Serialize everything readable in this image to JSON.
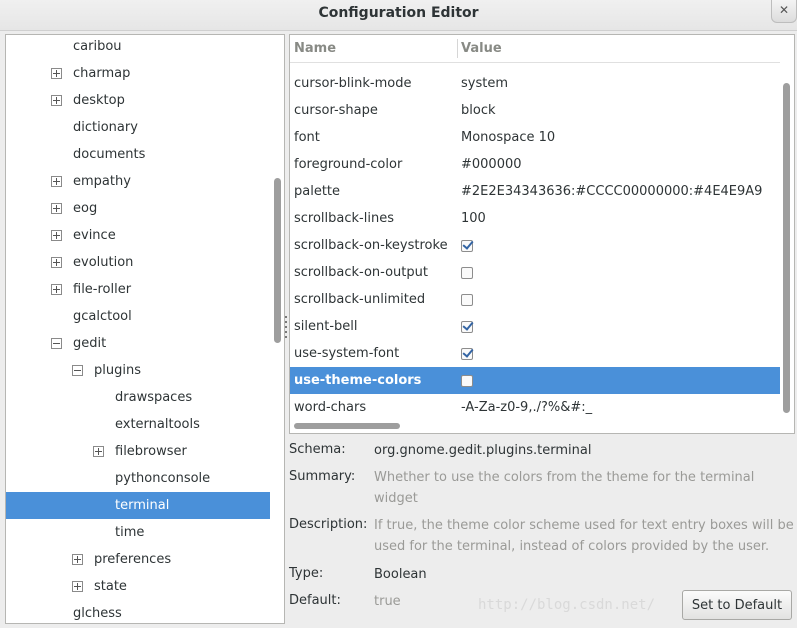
{
  "window": {
    "title": "Configuration Editor",
    "close_icon": "close-icon"
  },
  "tree": {
    "items": [
      {
        "label": "caribou",
        "expander": "none",
        "indent": 0,
        "selected": false
      },
      {
        "label": "charmap",
        "expander": "plus",
        "indent": 0,
        "selected": false
      },
      {
        "label": "desktop",
        "expander": "plus",
        "indent": 0,
        "selected": false
      },
      {
        "label": "dictionary",
        "expander": "none",
        "indent": 0,
        "selected": false
      },
      {
        "label": "documents",
        "expander": "none",
        "indent": 0,
        "selected": false
      },
      {
        "label": "empathy",
        "expander": "plus",
        "indent": 0,
        "selected": false
      },
      {
        "label": "eog",
        "expander": "plus",
        "indent": 0,
        "selected": false
      },
      {
        "label": "evince",
        "expander": "plus",
        "indent": 0,
        "selected": false
      },
      {
        "label": "evolution",
        "expander": "plus",
        "indent": 0,
        "selected": false
      },
      {
        "label": "file-roller",
        "expander": "plus",
        "indent": 0,
        "selected": false
      },
      {
        "label": "gcalctool",
        "expander": "none",
        "indent": 0,
        "selected": false
      },
      {
        "label": "gedit",
        "expander": "minus",
        "indent": 0,
        "selected": false
      },
      {
        "label": "plugins",
        "expander": "minus",
        "indent": 1,
        "selected": false
      },
      {
        "label": "drawspaces",
        "expander": "none",
        "indent": 2,
        "selected": false
      },
      {
        "label": "externaltools",
        "expander": "none",
        "indent": 2,
        "selected": false
      },
      {
        "label": "filebrowser",
        "expander": "plus",
        "indent": 2,
        "selected": false
      },
      {
        "label": "pythonconsole",
        "expander": "none",
        "indent": 2,
        "selected": false
      },
      {
        "label": "terminal",
        "expander": "none",
        "indent": 2,
        "selected": true
      },
      {
        "label": "time",
        "expander": "none",
        "indent": 2,
        "selected": false
      },
      {
        "label": "preferences",
        "expander": "plus",
        "indent": 1,
        "selected": false
      },
      {
        "label": "state",
        "expander": "plus",
        "indent": 1,
        "selected": false
      },
      {
        "label": "glchess",
        "expander": "none",
        "indent": 0,
        "selected": false
      }
    ]
  },
  "list": {
    "header": {
      "name": "Name",
      "value": "Value"
    },
    "rows": [
      {
        "name": "cursor-blink-mode",
        "type": "text",
        "value": "system",
        "selected": false
      },
      {
        "name": "cursor-shape",
        "type": "text",
        "value": "block",
        "selected": false
      },
      {
        "name": "font",
        "type": "text",
        "value": "Monospace 10",
        "selected": false
      },
      {
        "name": "foreground-color",
        "type": "text",
        "value": "#000000",
        "selected": false
      },
      {
        "name": "palette",
        "type": "text",
        "value": "#2E2E34343636:#CCCC00000000:#4E4E9A9",
        "selected": false
      },
      {
        "name": "scrollback-lines",
        "type": "text",
        "value": "100",
        "selected": false
      },
      {
        "name": "scrollback-on-keystroke",
        "type": "bool",
        "checked": true,
        "selected": false
      },
      {
        "name": "scrollback-on-output",
        "type": "bool",
        "checked": false,
        "selected": false
      },
      {
        "name": "scrollback-unlimited",
        "type": "bool",
        "checked": false,
        "selected": false
      },
      {
        "name": "silent-bell",
        "type": "bool",
        "checked": true,
        "selected": false
      },
      {
        "name": "use-system-font",
        "type": "bool",
        "checked": true,
        "selected": false
      },
      {
        "name": "use-theme-colors",
        "type": "bool",
        "checked": false,
        "selected": true
      },
      {
        "name": "word-chars",
        "type": "text",
        "value": "-A-Za-z0-9,./?%&#:_",
        "selected": false
      }
    ]
  },
  "details": {
    "schema_label": "Schema:",
    "schema_value": "org.gnome.gedit.plugins.terminal",
    "summary_label": "Summary:",
    "summary_value": "Whether to use the colors from the theme for the terminal widget",
    "description_label": "Description:",
    "description_value": "If true, the theme color scheme used for text entry boxes will be used for the terminal, instead of colors provided by the user.",
    "type_label": "Type:",
    "type_value": "Boolean",
    "default_label": "Default:",
    "default_value": "true"
  },
  "buttons": {
    "set_default": "Set to Default"
  },
  "watermark": "http://blog.csdn.net/"
}
